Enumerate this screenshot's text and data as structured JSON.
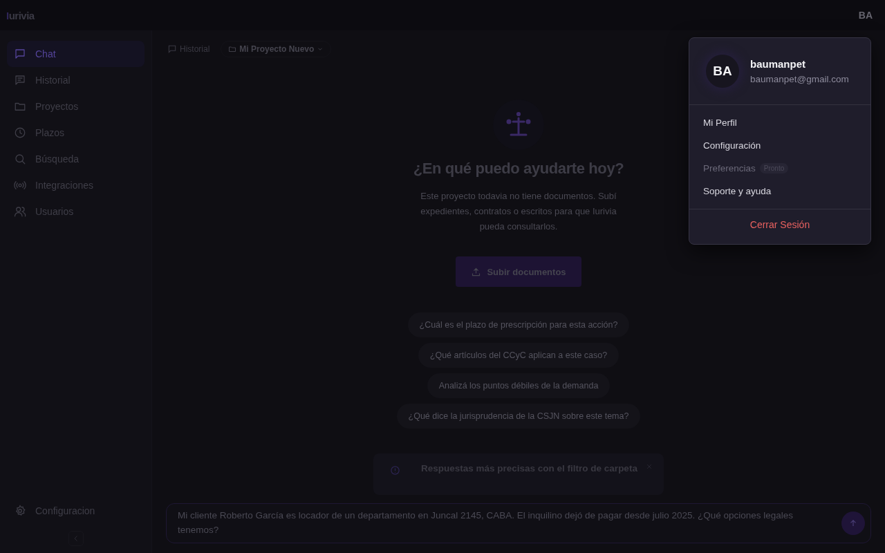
{
  "header": {
    "logo": "Iurivia",
    "user_initials": "BA"
  },
  "sidebar": {
    "items": [
      {
        "label": "Chat",
        "kind": "chat",
        "selected": true
      },
      {
        "label": "Historial",
        "kind": "message",
        "selected": false
      },
      {
        "label": "Proyectos",
        "kind": "folder",
        "selected": false
      },
      {
        "label": "Plazos",
        "kind": "clock",
        "selected": false
      },
      {
        "label": "Búsqueda",
        "kind": "search",
        "selected": false
      },
      {
        "label": "Integraciones",
        "kind": "signal",
        "selected": false
      },
      {
        "label": "Usuarios",
        "kind": "users",
        "selected": false
      }
    ],
    "footer": {
      "label": "Configuracion"
    }
  },
  "toolbar": {
    "history": "Historial",
    "project": "Mi Proyecto Nuevo"
  },
  "empty_state": {
    "title": "¿En qué puedo ayudarte hoy?",
    "text": "Este proyecto todavia no tiene documentos. Subí expedientes, contratos o escritos para que Iurivia pueda consultarlos.",
    "button": "Subir documentos"
  },
  "suggestions": [
    "¿Cuál es el plazo de prescripción para esta acción?",
    "¿Qué artículos del CCyC aplican a este caso?",
    "Analizá los puntos débiles de la demanda",
    "¿Qué dice la jurisprudencia de la CSJN sobre este tema?"
  ],
  "notice": {
    "title": "Respuestas más precisas con el filtro de carpeta"
  },
  "composer": {
    "value": "Mi cliente Roberto García es locador de un departamento en Juncal 2145, CABA. El inquilino dejó de pagar desde julio 2025. ¿Qué opciones legales tenemos?"
  },
  "user_menu": {
    "initials": "BA",
    "name": "baumanpet",
    "email": "baumanpet@gmail.com",
    "items": [
      {
        "label": "Mi Perfil",
        "disabled": false
      },
      {
        "label": "Configuración",
        "disabled": false
      },
      {
        "label": "Preferencias",
        "disabled": true,
        "badge": "Pronto"
      },
      {
        "label": "Soporte y ayuda",
        "disabled": false
      }
    ],
    "logout": "Cerrar Sesión"
  }
}
